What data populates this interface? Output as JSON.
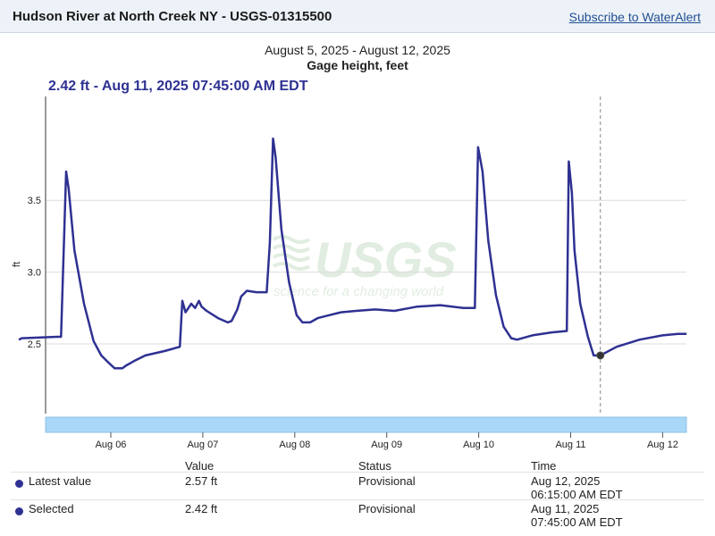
{
  "header": {
    "title": "Hudson River at North Creek NY - USGS-01315500",
    "subscribe_label": "Subscribe to WaterAlert"
  },
  "chart_meta": {
    "period": "August 5, 2025 - August 12, 2025",
    "title": "Gage height, feet",
    "readout": "2.42 ft - Aug 11, 2025 07:45:00 AM EDT",
    "watermark_text": "USGS",
    "watermark_tagline": "science for a changing world"
  },
  "chart_data": {
    "type": "line",
    "title": "Gage height, feet",
    "xlabel": "",
    "ylabel": "ft",
    "x_ticks": [
      "Aug 06",
      "Aug 07",
      "Aug 08",
      "Aug 09",
      "Aug 10",
      "Aug 11",
      "Aug 12"
    ],
    "y_ticks": [
      "2.5",
      "3.0",
      "3.5"
    ],
    "ylim": [
      2.0,
      4.0
    ],
    "grid": true,
    "selected_point": {
      "time": "Aug 11, 2025 07:45:00 AM EDT",
      "value": 2.42
    },
    "series": [
      {
        "name": "",
        "color": "#2e3192",
        "x": [
          "Aug 5 00:00",
          "Aug 5 00:45",
          "Aug 5 10:00",
          "Aug 5 11:00",
          "Aug 5 12:20",
          "Aug 5 13:00",
          "Aug 5 14:30",
          "Aug 5 17:00",
          "Aug 5 19:30",
          "Aug 5 21:30",
          "Aug 5 23:00",
          "Aug 6 01:00",
          "Aug 6 03:00",
          "Aug 6 04:00",
          "Aug 6 06:00",
          "Aug 6 09:00",
          "Aug 6 14:00",
          "Aug 6 18:00",
          "Aug 6 18:40",
          "Aug 6 19:30",
          "Aug 6 21:00",
          "Aug 6 22:00",
          "Aug 6 23:00",
          "Aug 6 23:40",
          "Aug 7 01:00",
          "Aug 7 04:00",
          "Aug 7 06:30",
          "Aug 7 07:30",
          "Aug 7 09:00",
          "Aug 7 10:00",
          "Aug 7 11:30",
          "Aug 7 14:00",
          "Aug 7 16:40",
          "Aug 7 17:30",
          "Aug 7 18:20",
          "Aug 7 19:00",
          "Aug 7 20:30",
          "Aug 7 22:30",
          "Aug 8 00:30",
          "Aug 8 02:00",
          "Aug 8 04:00",
          "Aug 8 06:00",
          "Aug 8 09:00",
          "Aug 8 12:00",
          "Aug 8 16:00",
          "Aug 8 21:00",
          "Aug 9 02:00",
          "Aug 9 08:00",
          "Aug 9 14:00",
          "Aug 9 20:00",
          "Aug 9 23:00",
          "Aug 9 23:50",
          "Aug 10 01:00",
          "Aug 10 02:30",
          "Aug 10 04:30",
          "Aug 10 06:30",
          "Aug 10 08:30",
          "Aug 10 10:00",
          "Aug 10 14:00",
          "Aug 10 19:00",
          "Aug 10 23:00",
          "Aug 10 23:30",
          "Aug 11 00:20",
          "Aug 11 01:00",
          "Aug 11 02:30",
          "Aug 11 04:30",
          "Aug 11 06:00",
          "Aug 11 07:45",
          "Aug 11 12:00",
          "Aug 11 18:00",
          "Aug 12 00:00",
          "Aug 12 04:00",
          "Aug 12 06:15"
        ],
        "values": [
          2.53,
          2.54,
          2.55,
          2.55,
          3.7,
          3.58,
          3.15,
          2.78,
          2.52,
          2.42,
          2.38,
          2.33,
          2.33,
          2.35,
          2.38,
          2.42,
          2.45,
          2.48,
          2.8,
          2.72,
          2.78,
          2.75,
          2.8,
          2.76,
          2.73,
          2.68,
          2.65,
          2.66,
          2.74,
          2.83,
          2.87,
          2.86,
          2.86,
          3.2,
          3.93,
          3.8,
          3.3,
          2.93,
          2.7,
          2.65,
          2.65,
          2.68,
          2.7,
          2.72,
          2.73,
          2.74,
          2.73,
          2.76,
          2.77,
          2.75,
          2.75,
          3.87,
          3.7,
          3.22,
          2.84,
          2.62,
          2.54,
          2.53,
          2.56,
          2.58,
          2.59,
          3.77,
          3.55,
          3.15,
          2.78,
          2.55,
          2.42,
          2.42,
          2.48,
          2.53,
          2.56,
          2.57,
          2.57
        ]
      }
    ]
  },
  "table": {
    "headers": {
      "value": "Value",
      "status": "Status",
      "time": "Time"
    },
    "rows": [
      {
        "label": "Latest value",
        "value": "2.57 ft",
        "status": "Provisional",
        "time_date": "Aug 12, 2025",
        "time_clock": "06:15:00 AM EDT"
      },
      {
        "label": "Selected",
        "value": "2.42 ft",
        "status": "Provisional",
        "time_date": "Aug 11, 2025",
        "time_clock": "07:45:00 AM EDT"
      }
    ]
  }
}
